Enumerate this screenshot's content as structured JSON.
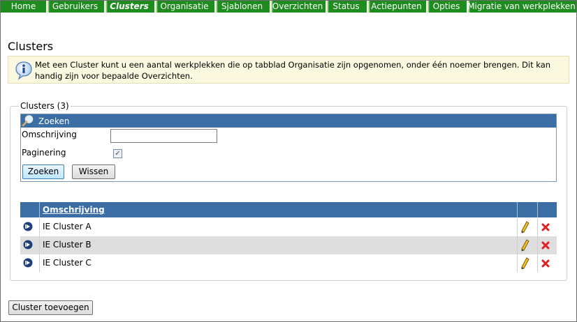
{
  "nav": {
    "tabs": [
      {
        "label": "Home",
        "active": false
      },
      {
        "label": "Gebruikers",
        "active": false
      },
      {
        "label": "Clusters",
        "active": true
      },
      {
        "label": "Organisatie",
        "active": false
      },
      {
        "label": "Sjablonen",
        "active": false
      },
      {
        "label": "Overzichten",
        "active": false
      },
      {
        "label": "Status",
        "active": false
      },
      {
        "label": "Actiepunten",
        "active": false
      },
      {
        "label": "Opties",
        "active": false
      },
      {
        "label": "Migratie van werkplekken",
        "active": false
      }
    ]
  },
  "page": {
    "title": "Clusters",
    "info_text": "Met een Cluster kunt u een aantal werkplekken die op tabblad Organisatie zijn opgenomen, onder één noemer brengen. Dit kan handig zijn voor bepaalde Overzichten."
  },
  "clusters": {
    "legend": "Clusters (3)",
    "search": {
      "title": "Zoeken",
      "omschrijving_label": "Omschrijving",
      "omschrijving_value": "",
      "paginering_label": "Paginering",
      "paginering_checked": true,
      "search_button": "Zoeken",
      "clear_button": "Wissen"
    },
    "table": {
      "header_omschrijving": "Omschrijving",
      "rows": [
        {
          "name": "IE Cluster A"
        },
        {
          "name": "IE Cluster B"
        },
        {
          "name": "IE Cluster C"
        }
      ]
    }
  },
  "add_button": "Cluster toevoegen",
  "colors": {
    "nav_bg": "#1f8c1f",
    "header_blue": "#3a6ea5",
    "info_bg": "#fbf8e0",
    "delete_red": "#e02020"
  }
}
